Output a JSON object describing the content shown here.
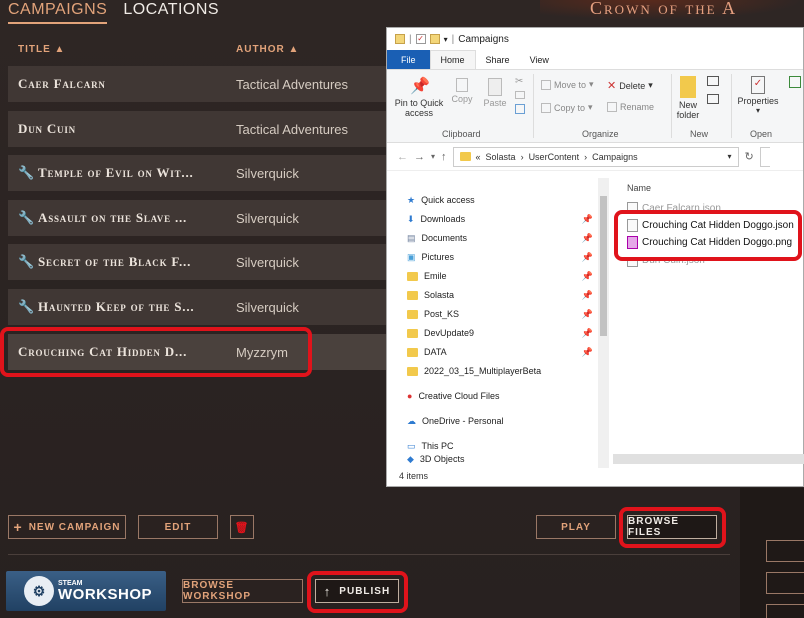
{
  "game": {
    "tabs": [
      "CAMPAIGNS",
      "LOCATIONS"
    ],
    "logo": "Crown of the A",
    "columns": {
      "title": "TITLE ▲",
      "author": "AUTHOR ▲"
    },
    "rows": [
      {
        "title": "Caer Falcarn",
        "author": "Tactical Adventures"
      },
      {
        "title": "Dun Cuin",
        "author": "Tactical Adventures"
      },
      {
        "title": "Temple of Evil on Wit...",
        "author": "Silverquick"
      },
      {
        "title": "Assault on the Slave ...",
        "author": "Silverquick"
      },
      {
        "title": "Secret of the Black F...",
        "author": "Silverquick"
      },
      {
        "title": "Haunted Keep of the S...",
        "author": "Silverquick"
      },
      {
        "title": "Crouching Cat Hidden D...",
        "author": "Myzzrym"
      }
    ],
    "buttons": {
      "new_campaign": "NEW CAMPAIGN",
      "new_campaign_icon": "+",
      "edit": "EDIT",
      "delete_icon": "🗑",
      "play": "PLAY",
      "browse_files": "BROWSE FILES",
      "browse_workshop": "BROWSE WORKSHOP",
      "publish": "PUBLISH",
      "publish_icon": "↑"
    },
    "steam": {
      "small": "STEAM",
      "big": "WORKSHOP"
    }
  },
  "explorer": {
    "title": "Campaigns",
    "ribbon_tabs": [
      "File",
      "Home",
      "Share",
      "View"
    ],
    "ribbon": {
      "pin": "Pin to Quick access",
      "copy": "Copy",
      "paste": "Paste",
      "clipboard": "Clipboard",
      "move_to": "Move to",
      "copy_to": "Copy to",
      "delete": "Delete",
      "rename": "Rename",
      "organize": "Organize",
      "new_folder": "New folder",
      "new": "New",
      "properties": "Properties",
      "open": "Open"
    },
    "path": [
      "Solasta",
      "UserContent",
      "Campaigns"
    ],
    "path_prefix": "«",
    "nav_items": [
      {
        "label": "Quick access",
        "icon": "star-icon",
        "pinned": false
      },
      {
        "label": "Downloads",
        "icon": "download-icon",
        "pinned": true
      },
      {
        "label": "Documents",
        "icon": "document-icon",
        "pinned": true
      },
      {
        "label": "Pictures",
        "icon": "picture-icon",
        "pinned": true
      },
      {
        "label": "Emile",
        "icon": "folder-icon",
        "pinned": true
      },
      {
        "label": "Solasta",
        "icon": "folder-icon",
        "pinned": true
      },
      {
        "label": "Post_KS",
        "icon": "folder-icon",
        "pinned": true
      },
      {
        "label": "DevUpdate9",
        "icon": "folder-icon",
        "pinned": true
      },
      {
        "label": "DATA",
        "icon": "folder-icon",
        "pinned": true
      },
      {
        "label": "2022_03_15_MultiplayerBeta",
        "icon": "folder-icon",
        "pinned": false
      },
      {
        "label": "Creative Cloud Files",
        "icon": "cloud-icon",
        "pinned": false
      },
      {
        "label": "OneDrive - Personal",
        "icon": "cloud-icon",
        "pinned": false
      },
      {
        "label": "This PC",
        "icon": "pc-icon",
        "pinned": false
      },
      {
        "label": "3D Objects",
        "icon": "folder-icon",
        "pinned": false
      }
    ],
    "file_header": "Name",
    "files": [
      {
        "name": "Caer Falcarn.json",
        "type": "json"
      },
      {
        "name": "Crouching Cat Hidden Doggo.json",
        "type": "json"
      },
      {
        "name": "Crouching Cat Hidden Doggo.png",
        "type": "png"
      },
      {
        "name": "Dun Cuin.json",
        "type": "json"
      }
    ],
    "status": "4 items"
  },
  "colors": {
    "highlight": "#e0131b",
    "accent": "#e2a37a",
    "row_bg": "#403734"
  }
}
